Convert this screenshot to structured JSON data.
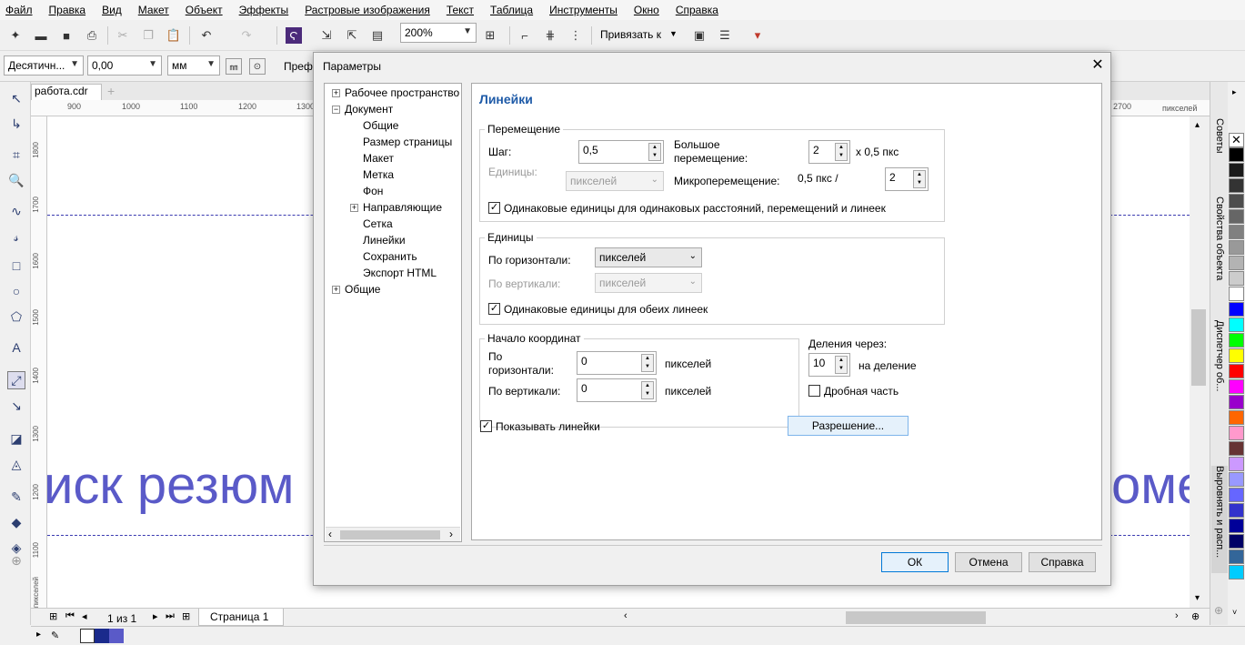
{
  "menu": [
    "Файл",
    "Правка",
    "Вид",
    "Макет",
    "Объект",
    "Эффекты",
    "Растровые изображения",
    "Текст",
    "Таблица",
    "Инструменты",
    "Окно",
    "Справка"
  ],
  "toolbar": {
    "zoom_value": "200%",
    "snap_label": "Привязать к"
  },
  "propbar": {
    "number_format": "Десятичн...",
    "value": "0,00",
    "unit": "мм",
    "label_pref": "Преф"
  },
  "document": {
    "tab_name": "работа.cdr",
    "ruler_h_ticks": [
      "900",
      "1000",
      "1100",
      "1200",
      "1300",
      "2700"
    ],
    "ruler_unit": "пикселей",
    "ruler_v_ticks": [
      "1800",
      "1700",
      "1600",
      "1500",
      "1400",
      "1300",
      "1200",
      "1100"
    ],
    "ruler_v_unit": "пикселей",
    "canvas_text_left": "иск резюм",
    "canvas_text_right": "оме"
  },
  "statusbar": {
    "page_counter": "1 из 1",
    "page_tab": "Страница 1"
  },
  "dockers": [
    "Советы",
    "Свойства объекта",
    "Диспетчер об...",
    "Выровнять и расп..."
  ],
  "palette_colors": [
    "#000000",
    "#1a1a1a",
    "#333333",
    "#4d4d4d",
    "#666666",
    "#808080",
    "#999999",
    "#b3b3b3",
    "#cccccc",
    "#ffffff",
    "#0000ff",
    "#00ffff",
    "#00ff00",
    "#ffff00",
    "#ff0000",
    "#ff00ff",
    "#9900cc",
    "#ff6600",
    "#ff99cc",
    "#663333",
    "#cc99ff",
    "#9999ff",
    "#6666ff",
    "#3333cc",
    "#000099",
    "#000066",
    "#336699",
    "#00ccff"
  ],
  "dialog": {
    "title": "Параметры",
    "tree": {
      "workspace": "Рабочее пространство",
      "document": "Документ",
      "children": [
        "Общие",
        "Размер страницы",
        "Макет",
        "Метка",
        "Фон",
        "Направляющие",
        "Сетка",
        "Линейки",
        "Сохранить",
        "Экспорт HTML"
      ],
      "general": "Общие"
    },
    "panel_title": "Линейки",
    "nudge": {
      "group": "Перемещение",
      "step_label": "Шаг:",
      "step_value": "0,5",
      "units_label": "Единицы:",
      "units_value": "пикселей",
      "big_nudge_label_1": "Большое",
      "big_nudge_label_2": "перемещение:",
      "big_nudge_value": "2",
      "big_nudge_suffix": "x 0,5 пкс",
      "micro_label": "Микроперемещение:",
      "micro_prefix": "0,5 пкс /",
      "micro_value": "2",
      "same_units_check": "Одинаковые единицы для одинаковых расстояний, перемещений и линеек"
    },
    "units": {
      "group": "Единицы",
      "horizontal_label": "По горизонтали:",
      "horizontal_value": "пикселей",
      "vertical_label": "По вертикали:",
      "vertical_value": "пикселей",
      "same_units_check": "Одинаковые единицы для обеих линеек"
    },
    "origin": {
      "group": "Начало координат",
      "horizontal_label_1": "По",
      "horizontal_label_2": "горизонтали:",
      "horizontal_value": "0",
      "horizontal_unit": "пикселей",
      "vertical_label": "По вертикали:",
      "vertical_value": "0",
      "vertical_unit": "пикселей"
    },
    "ticks": {
      "label": "Деления через:",
      "value": "10",
      "suffix": "на деление",
      "fraction_check": "Дробная часть"
    },
    "show_rulers_check": "Показывать линейки",
    "resolution_button": "Разрешение...",
    "ok_button": "ОК",
    "cancel_button": "Отмена",
    "help_button": "Справка"
  }
}
